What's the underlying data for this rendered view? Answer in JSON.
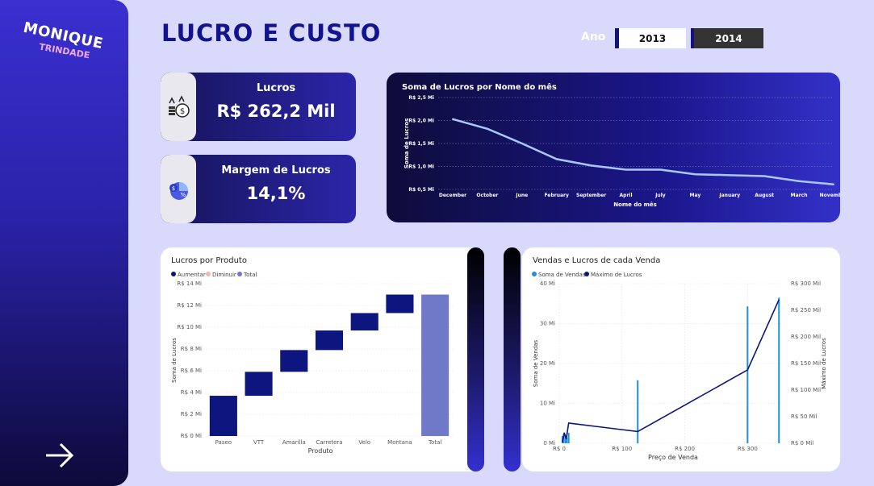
{
  "logo": {
    "line1": "MONIQUE",
    "line2": "TRINDADE"
  },
  "title": "LUCRO E CUSTO",
  "filter": {
    "label": "Ano",
    "options": [
      "2013",
      "2014"
    ],
    "selected": "2013"
  },
  "kpis": {
    "lucros": {
      "label": "Lucros",
      "value": "R$ 262,2 Mil"
    },
    "margem": {
      "label": "Margem de Lucros",
      "value": "14,1%"
    }
  },
  "colors": {
    "accent": "#12148f",
    "line": "#a9c8ff",
    "bar": "#0d157e",
    "total": "#7078c8",
    "sales": "#1f8fdc"
  },
  "chart_data": [
    {
      "type": "line",
      "title": "Soma de Lucros por Nome do mês",
      "xlabel": "Nome do mês",
      "ylabel": "Soma de Lucros",
      "categories": [
        "December",
        "October",
        "June",
        "February",
        "September",
        "April",
        "July",
        "May",
        "January",
        "August",
        "March",
        "November"
      ],
      "values": [
        2.03,
        1.82,
        1.5,
        1.16,
        1.02,
        0.93,
        0.93,
        0.83,
        0.81,
        0.79,
        0.68,
        0.61
      ],
      "yticks": [
        "R$ 0,5 Mi",
        "R$ 1,0 Mi",
        "R$ 1,5 Mi",
        "R$ 2,0 Mi",
        "R$ 2,5 Mi"
      ],
      "ylim": [
        0.5,
        2.5
      ]
    },
    {
      "type": "bar",
      "title": "Lucros por Produto",
      "xlabel": "Produto",
      "ylabel": "Soma de Lucros",
      "legend": [
        "Aumentar",
        "Diminuir",
        "Total"
      ],
      "categories": [
        "Paseo",
        "VTT",
        "Amarilla",
        "Carretera",
        "Velo",
        "Montana",
        "Total"
      ],
      "steps": [
        [
          0,
          3.7
        ],
        [
          3.7,
          5.9
        ],
        [
          5.9,
          7.9
        ],
        [
          7.9,
          9.7
        ],
        [
          9.7,
          11.3
        ],
        [
          11.3,
          13.0
        ],
        [
          0,
          13.0
        ]
      ],
      "yticks": [
        "R$ 0 Mi",
        "R$ 2 Mi",
        "R$ 4 Mi",
        "R$ 6 Mi",
        "R$ 8 Mi",
        "R$ 10 Mi",
        "R$ 12 Mi",
        "R$ 14 Mi"
      ],
      "ylim": [
        0,
        14
      ]
    },
    {
      "type": "line",
      "title": "Vendas e Lucros de cada Venda",
      "xlabel": "Preço de Venda",
      "ylabel": "Soma de Vendas",
      "y2label": "Máximo de Lucros",
      "legend": [
        "Soma de Vendas",
        "Máximo de Lucros"
      ],
      "xticks": [
        "R$ 0",
        "R$ 100",
        "R$ 200",
        "R$ 300"
      ],
      "yticks": [
        "0 Mi",
        "10 Mi",
        "20 Mi",
        "30 Mi",
        "40 Mi"
      ],
      "y2ticks": [
        "R$ 0 Mil",
        "R$ 50 Mil",
        "R$ 100 Mil",
        "R$ 150 Mil",
        "R$ 200 Mil",
        "R$ 250 Mil",
        "R$ 300 Mil"
      ],
      "xlim": [
        0,
        360
      ],
      "ylim": [
        0,
        40
      ],
      "y2lim": [
        0,
        300
      ],
      "sales": [
        [
          5,
          1.8
        ],
        [
          7,
          2.3
        ],
        [
          10,
          2.0
        ],
        [
          12,
          1.5
        ],
        [
          15,
          2.6
        ],
        [
          125,
          15.8
        ],
        [
          300,
          34.3
        ],
        [
          350,
          36.5
        ]
      ],
      "profit": [
        [
          5,
          2
        ],
        [
          8,
          20
        ],
        [
          11,
          8
        ],
        [
          15,
          38
        ],
        [
          125,
          22
        ],
        [
          300,
          138
        ],
        [
          350,
          270
        ]
      ]
    }
  ]
}
